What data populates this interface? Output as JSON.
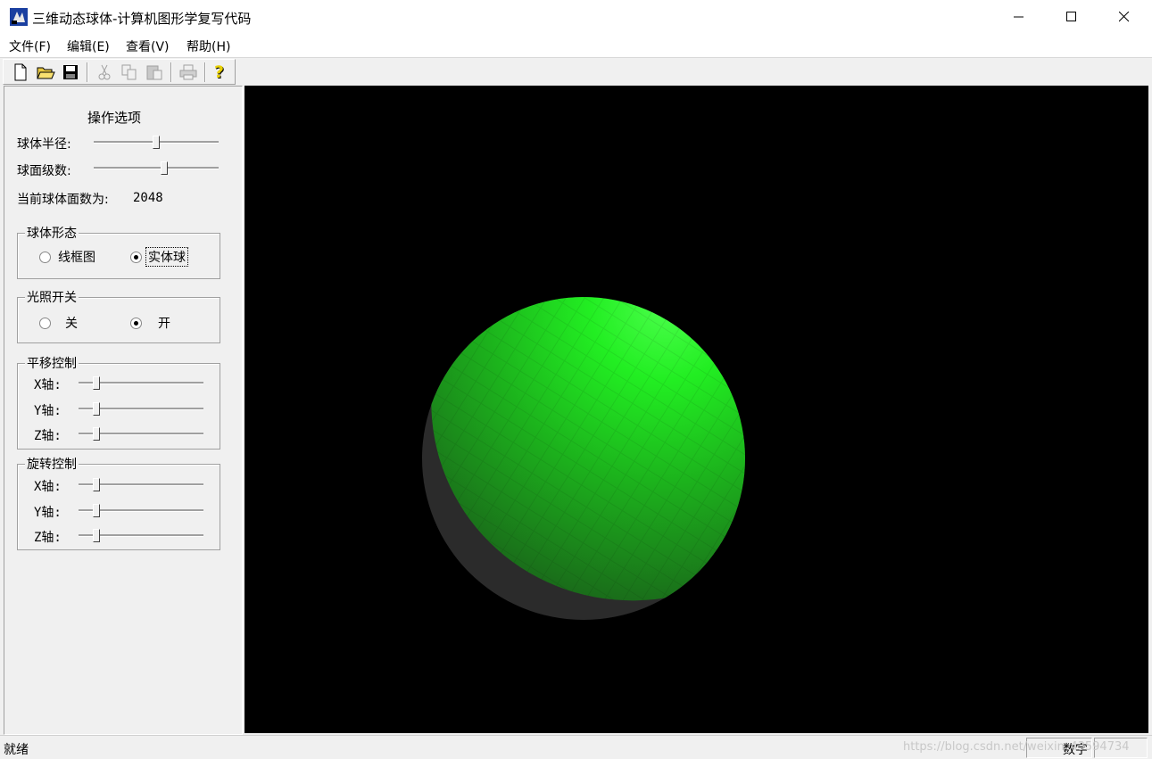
{
  "window": {
    "title": "三维动态球体-计算机图形学复写代码",
    "controls": {
      "minimize": "—",
      "maximize": "☐",
      "close": "✕"
    }
  },
  "menu": {
    "items": [
      "文件(F)",
      "编辑(E)",
      "查看(V)",
      "帮助(H)"
    ]
  },
  "toolbar": {
    "buttons": [
      {
        "name": "new-file-icon",
        "enabled": true
      },
      {
        "name": "open-folder-icon",
        "enabled": true
      },
      {
        "name": "save-icon",
        "enabled": true
      },
      {
        "name": "cut-icon",
        "enabled": false
      },
      {
        "name": "copy-icon",
        "enabled": false
      },
      {
        "name": "paste-icon",
        "enabled": false
      },
      {
        "name": "print-icon",
        "enabled": false
      },
      {
        "name": "help-icon",
        "enabled": true
      }
    ]
  },
  "panel": {
    "heading": "操作选项",
    "radius": {
      "label": "球体半径:",
      "value": 0.5
    },
    "levels": {
      "label": "球面级数:",
      "value": 0.57
    },
    "face_count": {
      "label": "当前球体面数为:",
      "value": "2048"
    },
    "shape_group": {
      "title": "球体形态",
      "options": [
        {
          "label": "线框图",
          "checked": false
        },
        {
          "label": "实体球",
          "checked": true
        }
      ]
    },
    "light_group": {
      "title": "光照开关",
      "options": [
        {
          "label": "关",
          "checked": false
        },
        {
          "label": "开",
          "checked": true
        }
      ]
    },
    "translate_group": {
      "title": "平移控制",
      "axes": [
        {
          "label": "X轴:",
          "value": 0.12
        },
        {
          "label": "Y轴:",
          "value": 0.12
        },
        {
          "label": "Z轴:",
          "value": 0.12
        }
      ]
    },
    "rotate_group": {
      "title": "旋转控制",
      "axes": [
        {
          "label": "X轴:",
          "value": 0.12
        },
        {
          "label": "Y轴:",
          "value": 0.12
        },
        {
          "label": "Z轴:",
          "value": 0.12
        }
      ]
    }
  },
  "viewport": {
    "background": "#000000",
    "sphere_color": "#22ee22",
    "shadow_color": "#2b2b2b"
  },
  "status": {
    "text": "就绪",
    "num_indicator": "数字",
    "watermark": "https://blog.csdn.net/weixin_43594734"
  }
}
